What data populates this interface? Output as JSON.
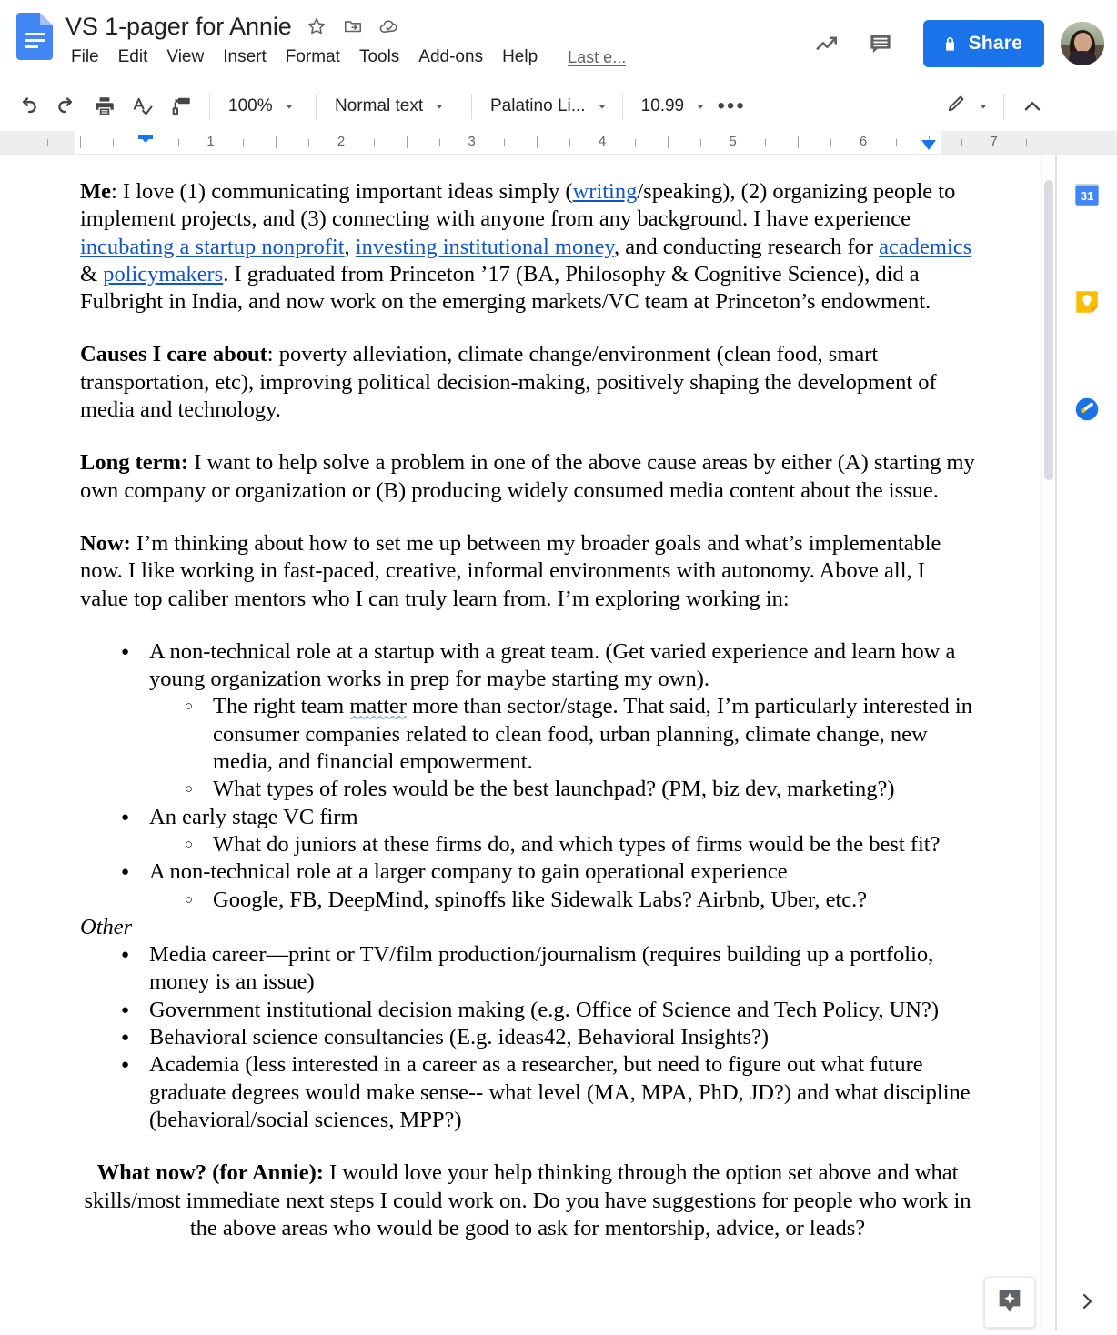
{
  "app": {
    "logo_icon": "google-docs-icon"
  },
  "header": {
    "doc_title": "VS 1-pager for Annie",
    "title_icons": [
      {
        "name": "star-icon",
        "glyph": "star"
      },
      {
        "name": "move-to-folder-icon",
        "glyph": "folder-move"
      },
      {
        "name": "cloud-saved-icon",
        "glyph": "cloud-check"
      }
    ],
    "menus": [
      "File",
      "Edit",
      "View",
      "Insert",
      "Format",
      "Tools",
      "Add-ons",
      "Help"
    ],
    "last_edit": "Last e...",
    "right_icons": [
      {
        "name": "activity-dashboard-icon",
        "glyph": "trending-up"
      },
      {
        "name": "comment-history-icon",
        "glyph": "comment"
      }
    ],
    "share_label": "Share",
    "share_color": "#1a73e8",
    "share_lock_icon": "lock-icon",
    "avatar": "user-avatar"
  },
  "toolbar": {
    "buttons": [
      {
        "name": "undo-button",
        "icon": "undo-icon"
      },
      {
        "name": "redo-button",
        "icon": "redo-icon"
      },
      {
        "name": "print-button",
        "icon": "print-icon"
      },
      {
        "name": "spelling-button",
        "icon": "spellcheck-icon"
      },
      {
        "name": "paint-format-button",
        "icon": "paint-roller-icon"
      }
    ],
    "zoom": "100%",
    "paragraph_style": "Normal text",
    "font": "Palatino Li...",
    "font_size": "10.99",
    "more_label": "•••",
    "editing_mode_icon": "pencil-icon",
    "hide_menus_icon": "chevron-up-icon"
  },
  "ruler": {
    "numbers": [
      "1",
      "2",
      "3",
      "4",
      "5",
      "6",
      "7"
    ],
    "left_indent_in": 0.5,
    "right_indent_in": 6.5
  },
  "document": {
    "paragraphs": {
      "me_lead": "Me",
      "me_p1": ": I love (1) communicating important ideas simply (",
      "me_link_writing": "writing",
      "me_p2": "/speaking), (2) organizing people to implement projects, and (3) connecting with anyone from any background. I have experience ",
      "me_link_incubating": "incubating a startup nonprofit",
      "me_p3": ", ",
      "me_link_investing": "investing institutional money",
      "me_p4": ", and conducting research for ",
      "me_link_academics": "academics",
      "me_p5": " & ",
      "me_link_policymakers": "policymakers",
      "me_p6": ". I graduated from Princeton ’17 (BA, Philosophy & Cognitive Science), did a Fulbright in India, and now work on the emerging markets/VC team at Princeton’s endowment.",
      "causes_lead": "Causes I care about",
      "causes_body": ": poverty alleviation, climate change/environment (clean food, smart transportation, etc), improving political decision-making, positively shaping the development of media and technology.",
      "longterm_lead": "Long term:",
      "longterm_body": " I want to help solve a problem in one of the above cause areas by either (A) starting my own company or organization or (B) producing widely consumed media content about the issue.",
      "now_lead": "Now:",
      "now_body": " I’m thinking about how to set me up between my broader goals and what’s implementable now. I like working in fast-paced, creative, informal environments with autonomy. Above all, I value top caliber mentors who I can truly learn from. I’m exploring working in:",
      "other_label": "Other",
      "whatnow_lead": "What now? (for Annie):",
      "whatnow_body": " I would love your help thinking through the option set above and what skills/most immediate next steps I could work on. Do you have suggestions for people who work in the above areas who would be good to ask for mentorship, advice, or leads?"
    },
    "bullets": {
      "b1": "A non-technical role at a startup with a great team. (Get varied experience and learn how a young organization works in prep for maybe starting my own).",
      "b1_s1_pre": "The right team ",
      "b1_s1_misspelled": "matter",
      "b1_s1_post": " more than sector/stage. That said, I’m particularly interested in consumer companies related to clean food, urban planning, climate change, new media, and financial empowerment.",
      "b1_s2": "What types of roles would be the best launchpad? (PM, biz dev, marketing?)",
      "b2": "An early stage VC firm",
      "b2_s1": "What do juniors at these firms do, and which types of firms would be the best fit?",
      "b3": "A non-technical role at a larger company to gain operational experience",
      "b3_s1": "Google, FB, DeepMind, spinoffs like Sidewalk Labs? Airbnb, Uber, etc.?",
      "o1": "Media career—print or TV/film production/journalism (requires building up a portfolio, money is an issue)",
      "o2": "Government institutional decision making (e.g. Office of Science and Tech Policy, UN?)",
      "o3": "Behavioral science consultancies (E.g. ideas42, Behavioral Insights?)",
      "o4": "Academia (less interested in a career as a researcher, but need to figure out what future graduate degrees would make sense-- what level (MA, MPA, PhD, JD?) and what discipline (behavioral/social sciences, MPP?)"
    }
  },
  "sidebar": {
    "items": [
      {
        "name": "google-calendar-icon",
        "label": "31"
      },
      {
        "name": "google-keep-icon",
        "label": ""
      },
      {
        "name": "google-tasks-icon",
        "label": ""
      }
    ],
    "expand_icon": "chevron-right-icon"
  },
  "explore": {
    "icon": "explore-sparkle-icon"
  },
  "colors": {
    "accent": "#1a73e8",
    "link": "#1155cc",
    "text": "#202124",
    "muted": "#5f6368",
    "spellcheck": "#4285f4"
  }
}
